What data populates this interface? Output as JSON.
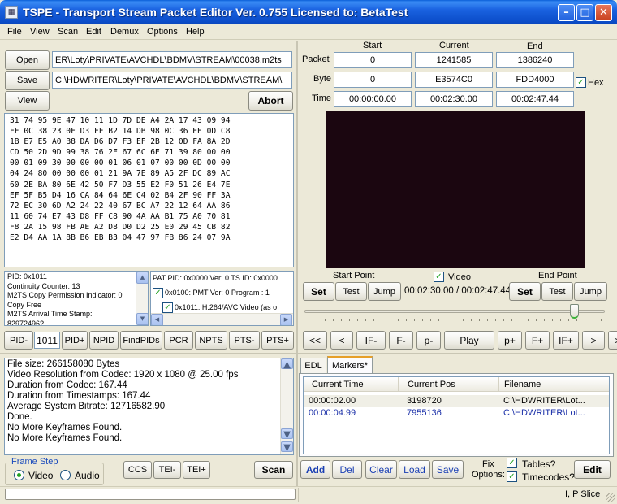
{
  "window": {
    "title": "TSPE - Transport Stream Packet Editor Ver. 0.755 Licensed to: BetaTest",
    "icon": "app-icon"
  },
  "menu": [
    "File",
    "View",
    "Scan",
    "Edit",
    "Demux",
    "Options",
    "Help"
  ],
  "files": {
    "open_label": "Open",
    "save_label": "Save",
    "view_label": "View",
    "abort_label": "Abort",
    "open_path": "ER\\Loty\\PRIVATE\\AVCHDL\\BDMV\\STREAM\\00038.m2ts",
    "save_path": "C:\\HDWRITER\\Loty\\PRIVATE\\AVCHDL\\BDMV\\STREAM\\"
  },
  "hex_lines": [
    "31 74 95 9E 47 10 11 1D 7D DE A4 2A 17 43 09 94",
    "FF 0C 38 23 0F D3 FF B2 14 DB 98 0C 36 EE 0D C8",
    "1B E7 E5 A0 B8 DA D6 D7 F3 EF 2B 12 0D FA 8A 2D",
    "CD 50 2D 9D 99 38 76 2E 67 6C 6E 71 39 80 00 00",
    "00 01 09 30 00 00 00 01 06 01 07 00 00 0D 00 00",
    "04 24 80 00 00 00 01 21 9A 7E 89 A5 2F DC 89 AC",
    "60 2E BA 80 6E 42 50 F7 D3 55 E2 F0 51 26 E4 7E",
    "EF 5F B5 D4 16 CA 84 64 6E C4 02 B4 2F 90 FF 3A",
    "72 EC 30 6D A2 24 22 40 67 BC A7 22 12 64 AA 86",
    "11 60 74 E7 43 D8 FF C8 90 4A AA B1 75 A0 70 81",
    "F8 2A 15 98 FB AE A2 D8 D0 D2 25 E0 29 45 CB 82",
    "E2 D4 AA 1A 8B B6 EB B3 04 47 97 FB 86 24 07 9A"
  ],
  "packet_info": [
    "PID: 0x1011",
    "Continuity Counter: 13",
    "M2TS Copy Permission Indicator: 0",
    "Copy Free",
    "M2TS Arrival Time Stamp:",
    "82972496?"
  ],
  "tree": {
    "root": "PAT PID: 0x0000 Ver: 0 TS ID: 0x0000",
    "child1": "0x0100: PMT Ver: 0 Program : 1",
    "child2": "0x1011: H.264/AVC Video (as o"
  },
  "pid_bar": {
    "pid_minus": "PID-",
    "pid_value": "1011",
    "pid_plus": "PID+",
    "npid": "NPID",
    "findpids": "FindPIDs",
    "pcr": "PCR",
    "npts": "NPTS",
    "pts_minus": "PTS-",
    "pts_plus": "PTS+"
  },
  "log_lines": [
    "File size: 266158080 Bytes",
    "Video Resolution from Codec: 1920 x 1080 @ 25.00 fps",
    "Duration from Codec: 167.44",
    "Duration from Timestamps: 167.44",
    "Average System Bitrate: 12716582.90",
    "Done.",
    "No More Keyframes Found.",
    "No More Keyframes Found."
  ],
  "frame_step": {
    "title": "Frame Step",
    "video_label": "Video",
    "audio_label": "Audio",
    "selected": "Video",
    "ccs": "CCS",
    "tei_minus": "TEI-",
    "tei_plus": "TEI+",
    "scan": "Scan"
  },
  "position": {
    "col_start": "Start",
    "col_current": "Current",
    "col_end": "End",
    "row_packet": "Packet",
    "row_byte": "Byte",
    "row_time": "Time",
    "packet_start": "0",
    "packet_current": "1241585",
    "packet_end": "1386240",
    "byte_start": "0",
    "byte_current": "E3574C0",
    "byte_end": "FDD4000",
    "time_start": "00:00:00.00",
    "time_current": "00:02:30.00",
    "time_end": "00:02:47.44",
    "hex_label": "Hex",
    "hex_checked": true
  },
  "playback": {
    "start_point_label": "Start Point",
    "end_point_label": "End Point",
    "video_label": "Video",
    "set": "Set",
    "test": "Test",
    "jump": "Jump",
    "time_display": "00:02:30.00 / 00:02:47.44",
    "slider_fraction": 0.9,
    "nav": [
      "<<",
      "<",
      "IF-",
      "F-",
      "p-",
      "Play",
      "p+",
      "F+",
      "IF+",
      ">",
      ">>"
    ]
  },
  "markers": {
    "tab_edl": "EDL",
    "tab_markers": "Markers*",
    "col_time": "Current Time",
    "col_pos": "Current Pos",
    "col_file": "Filename",
    "rows": [
      {
        "time": "00:00:02.00",
        "pos": "3198720",
        "file": "C:\\HDWRITER\\Lot..."
      },
      {
        "time": "00:00:04.99",
        "pos": "7955136",
        "file": "C:\\HDWRITER\\Lot..."
      }
    ],
    "add": "Add",
    "del": "Del",
    "clear": "Clear",
    "load": "Load",
    "save": "Save",
    "fix_label_1": "Fix",
    "fix_label_2": "Options:",
    "tables": "Tables?",
    "timecodes": "Timecodes?",
    "edit": "Edit"
  },
  "status": {
    "text": "I, P Slice"
  }
}
